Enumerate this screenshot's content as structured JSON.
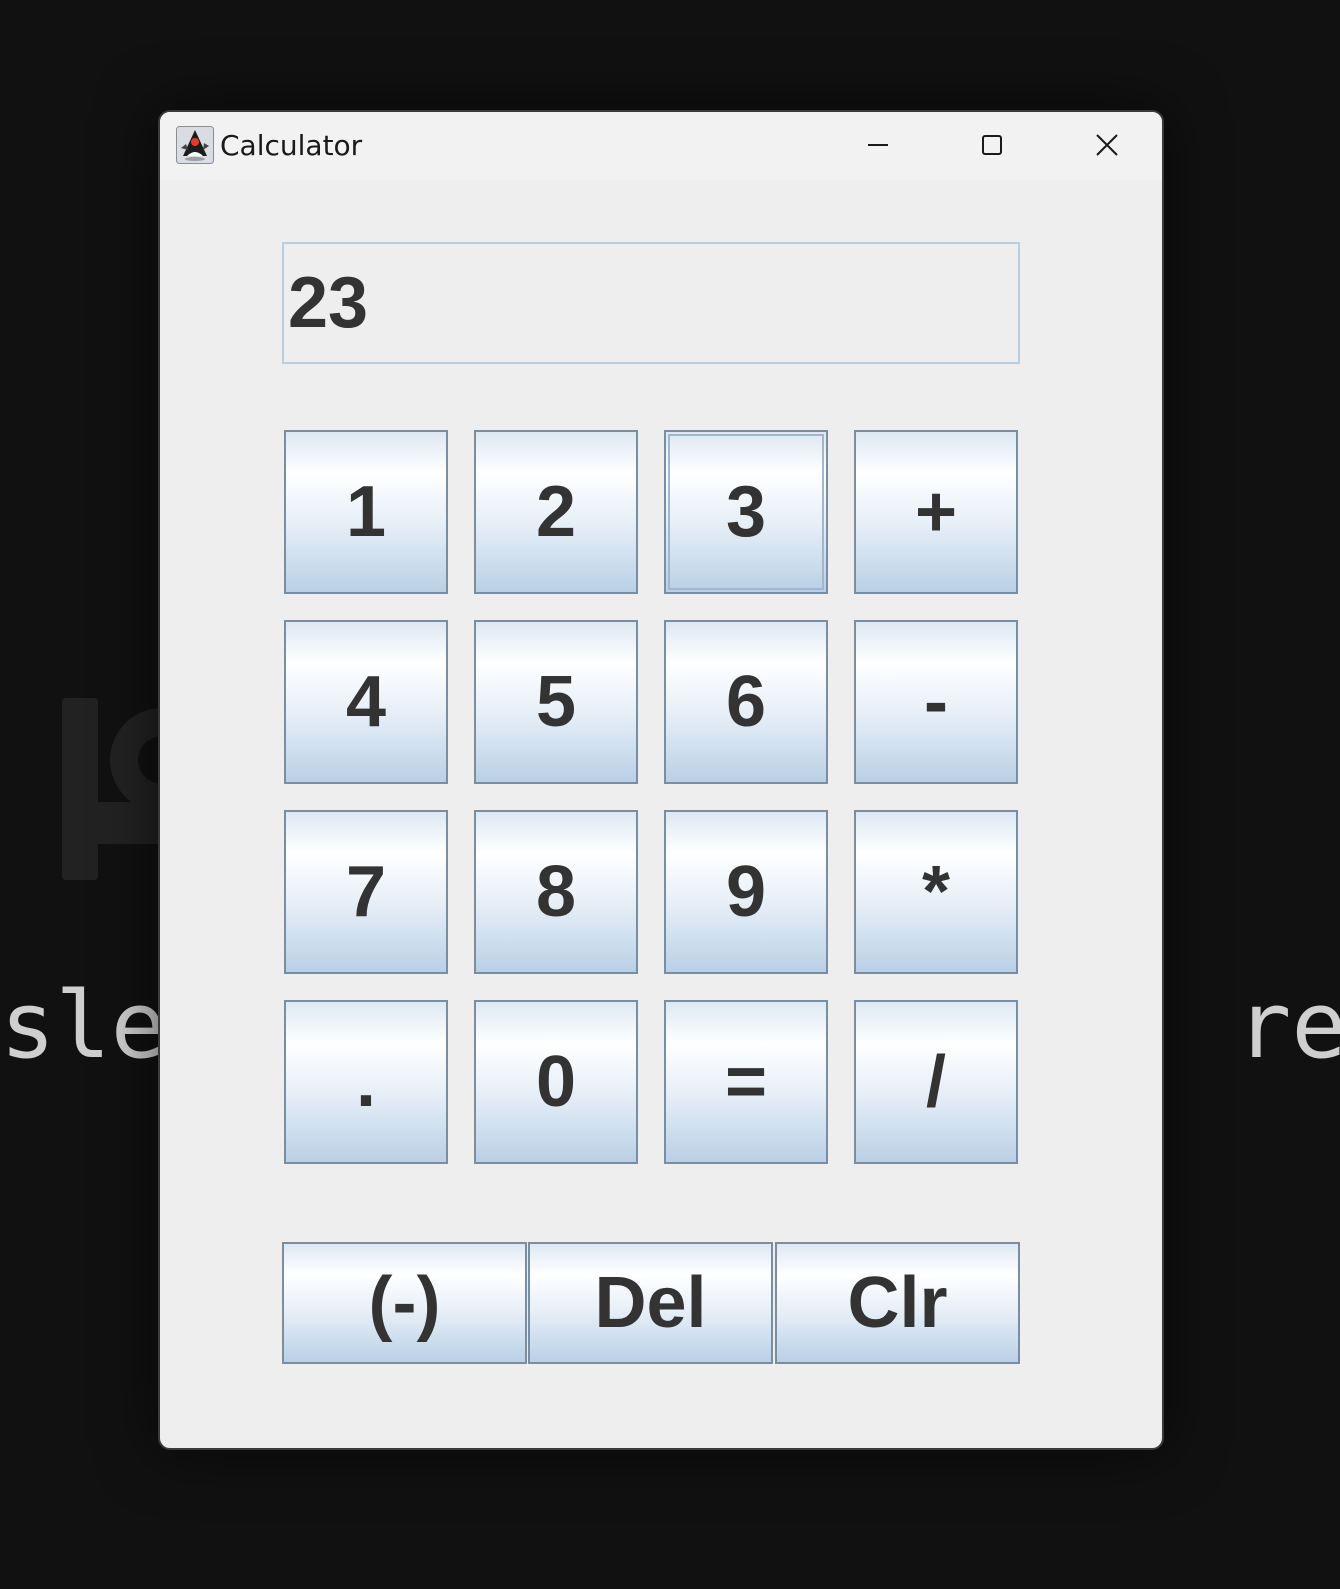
{
  "window": {
    "title": "Calculator"
  },
  "display": {
    "value": "23"
  },
  "keypad": {
    "k1": "1",
    "k2": "2",
    "k3": "3",
    "plus": "+",
    "k4": "4",
    "k5": "5",
    "k6": "6",
    "minus": "-",
    "k7": "7",
    "k8": "8",
    "k9": "9",
    "multiply": "*",
    "dot": ".",
    "k0": "0",
    "equals": "=",
    "divide": "/"
  },
  "bottom_row": {
    "negate": "(-)",
    "delete": "Del",
    "clear": "Clr"
  },
  "background": {
    "left_text": "sle",
    "right_text": "re"
  },
  "colors": {
    "desktop": "#111111",
    "window": "#eeeeee",
    "key_border": "#7a8ea2",
    "display_border": "#b8cfe2",
    "text": "#333333"
  }
}
